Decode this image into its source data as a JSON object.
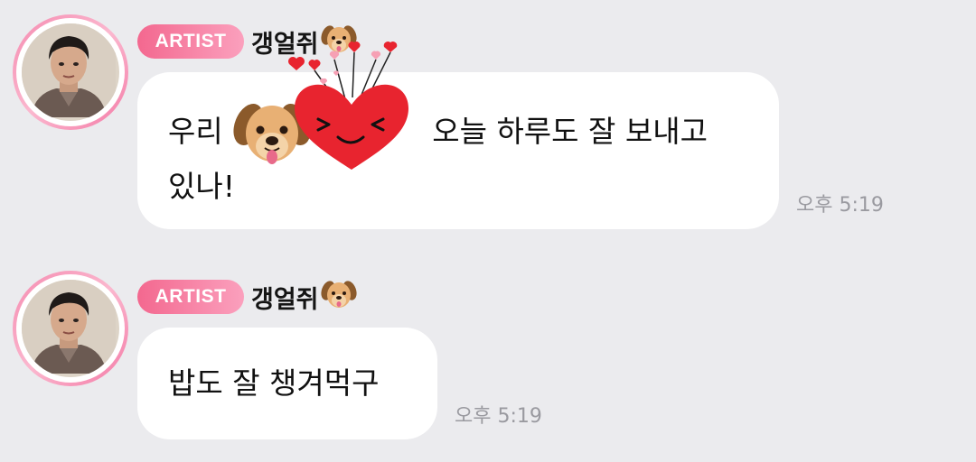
{
  "messages": [
    {
      "badge": "ARTIST",
      "sender": "갱얼쥐",
      "text_line1_a": "우리",
      "text_line1_b": "오늘 하루도 잘 보내고",
      "text_line2": "있나!",
      "time": "오후 5:19",
      "emoji_icon": "dog-face",
      "sticker_icon": "heart-face-with-small-hearts"
    },
    {
      "badge": "ARTIST",
      "sender": "갱얼쥐",
      "text": "밥도 잘 챙겨먹구",
      "time": "오후 5:19"
    }
  ],
  "colors": {
    "background": "#ebebee",
    "badge_start": "#f3688f",
    "badge_end": "#fba0bd",
    "bubble": "#ffffff",
    "time": "#9a9aa0",
    "heart": "#e8242f"
  }
}
